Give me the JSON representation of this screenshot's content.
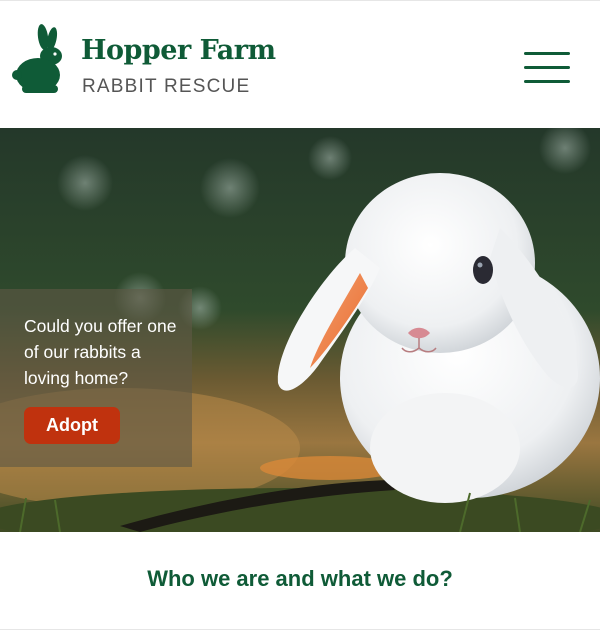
{
  "header": {
    "brand_name": "Hopper Farm",
    "brand_tagline": "RABBIT RESCUE",
    "logo_icon": "rabbit-icon",
    "menu_icon": "hamburger-menu-icon"
  },
  "hero": {
    "image": "white lop-eared rabbit on grass",
    "text": "Could you offer one of our rabbits a loving home?",
    "button_label": "Adopt"
  },
  "about": {
    "heading": "Who we are and what we do?"
  },
  "colors": {
    "brand_green": "#0f5b37",
    "accent_red": "#c0320e"
  }
}
